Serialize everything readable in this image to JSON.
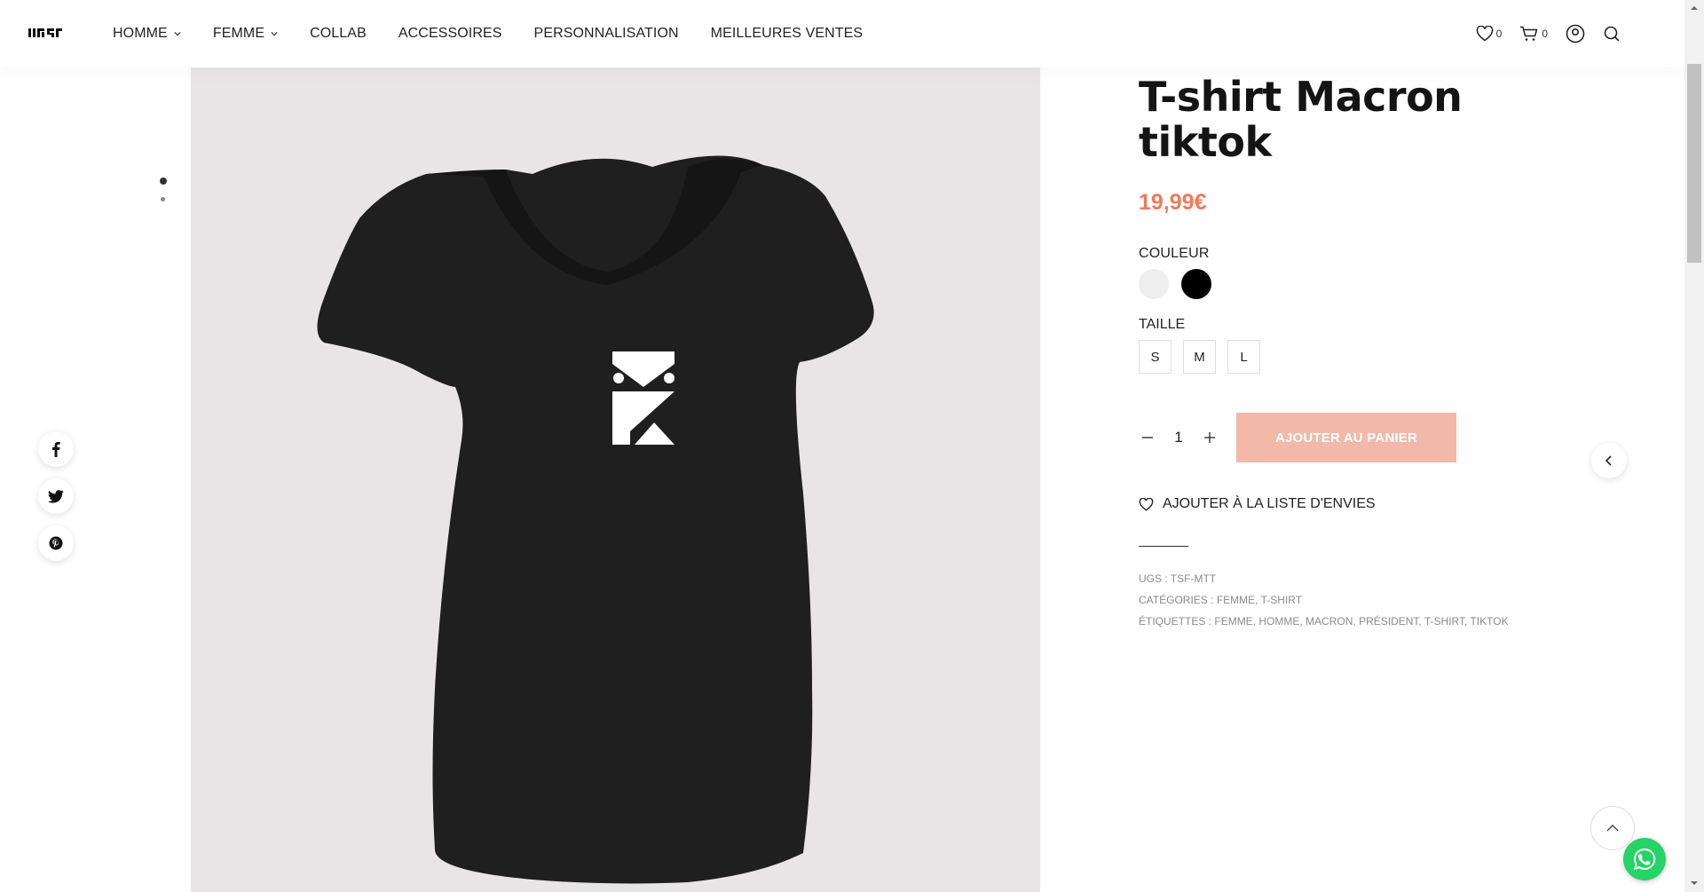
{
  "header": {
    "logo": "LUS",
    "nav": [
      {
        "label": "HOMME",
        "dropdown": true
      },
      {
        "label": "FEMME",
        "dropdown": true
      },
      {
        "label": "COLLAB",
        "dropdown": false
      },
      {
        "label": "ACCESSOIRES",
        "dropdown": false
      },
      {
        "label": "PERSONNALISATION",
        "dropdown": false
      },
      {
        "label": "MEILLEURES VENTES",
        "dropdown": false
      }
    ],
    "wishlist_count": "0",
    "cart_count": "0"
  },
  "gallery": {
    "dots": 2,
    "active_dot": 0
  },
  "social": [
    "facebook-icon",
    "twitter-icon",
    "pinterest-icon"
  ],
  "product": {
    "title": "T-shirt Macron tiktok",
    "price": "19,99€",
    "color_label": "COULEUR",
    "colors": [
      "#eeeeee",
      "#000000"
    ],
    "size_label": "TAILLE",
    "sizes": [
      "S",
      "M",
      "L"
    ],
    "quantity": "1",
    "add_to_cart": "AJOUTER AU PANIER",
    "wishlist": "AJOUTER À LA LISTE D'ENVIES",
    "sku_label": "UGS :",
    "sku": "TSF-MTT",
    "categories_label": "CATÉGORIES :",
    "categories": [
      "FEMME",
      "T-SHIRT"
    ],
    "tags_label": "ÉTIQUETTES :",
    "tags": [
      "FEMME",
      "HOMME",
      "MACRON",
      "PRÉSIDENT",
      "T-SHIRT",
      "TIKTOK"
    ]
  },
  "colors": {
    "accent": "#f07a5a",
    "button": "#f2b8a8",
    "image_bg": "#e9e5e6",
    "whatsapp": "#25d366"
  }
}
